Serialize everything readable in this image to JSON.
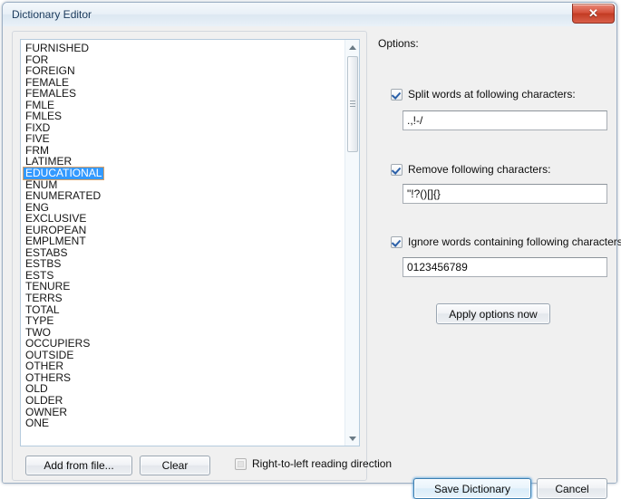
{
  "window": {
    "title": "Dictionary Editor",
    "close_glyph": "✕"
  },
  "wordlist": {
    "items": [
      "FURNISHED",
      "FOR",
      "FOREIGN",
      "FEMALE",
      "FEMALES",
      "FMLE",
      "FMLES",
      "FIXD",
      "FIVE",
      "FRM",
      "LATIMER",
      "EDUCATIONAL",
      "ENUM",
      "ENUMERATED",
      "ENG",
      "EXCLUSIVE",
      "EUROPEAN",
      "EMPLMENT",
      "ESTABS",
      "ESTBS",
      "ESTS",
      "TENURE",
      "TERRS",
      "TOTAL",
      "TYPE",
      "TWO",
      "OCCUPIERS",
      "OUTSIDE",
      "OTHER",
      "OTHERS",
      "OLD",
      "OLDER",
      "OWNER",
      "ONE"
    ],
    "selected_index": 11,
    "selected_value": "EDUCATIONAL",
    "selection_color": "#3399ff",
    "selection_border_color": "#d9a066"
  },
  "left_panel": {
    "add_from_file_label": "Add from file...",
    "clear_label": "Clear",
    "rtl_checkbox_label": "Right-to-left reading direction",
    "rtl_checked": false
  },
  "options": {
    "heading": "Options:",
    "split": {
      "label": "Split words at following characters:",
      "checked": true,
      "value": ".,!-/",
      "placeholder": ""
    },
    "remove": {
      "label": "Remove following characters:",
      "checked": true,
      "value": "\"!?()[]{}",
      "placeholder": ""
    },
    "ignore": {
      "label": "Ignore words containing following characters:",
      "checked": true,
      "value": "0123456789",
      "placeholder": ""
    },
    "apply_label": "Apply options now"
  },
  "actions": {
    "save_label": "Save Dictionary",
    "cancel_label": "Cancel",
    "default_button": "save"
  },
  "colors": {
    "accent": "#3399ff",
    "focus_border": "#3c7fb1",
    "close_button": "#c23a22",
    "window_bg": "#f0f0f0",
    "title_text": "#1b3a5c"
  }
}
